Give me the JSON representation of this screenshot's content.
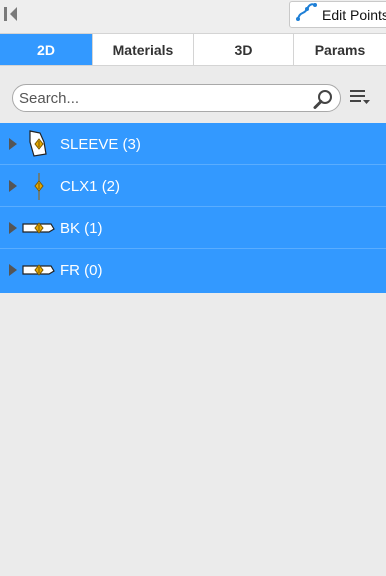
{
  "toolbar": {
    "collapse_icon": "collapse-panel-icon",
    "edit_points_label": "Edit Points",
    "edit_points_icon": "edit-points-curve-icon"
  },
  "tabs": [
    {
      "label": "2D",
      "active": true
    },
    {
      "label": "Materials",
      "active": false
    },
    {
      "label": "3D",
      "active": false
    },
    {
      "label": "Params",
      "active": false
    }
  ],
  "search": {
    "placeholder": "Search...",
    "value": "",
    "icon": "magnifier-icon",
    "sort_icon": "sort-list-icon"
  },
  "tree": {
    "selection_color": "#3399ff",
    "items": [
      {
        "label": "SLEEVE (3)",
        "icon": "sleeve-piece-icon"
      },
      {
        "label": "CLX1 (2)",
        "icon": "line-piece-icon"
      },
      {
        "label": "BK (1)",
        "icon": "flat-piece-icon"
      },
      {
        "label": "FR (0)",
        "icon": "flat-piece-icon"
      }
    ]
  }
}
